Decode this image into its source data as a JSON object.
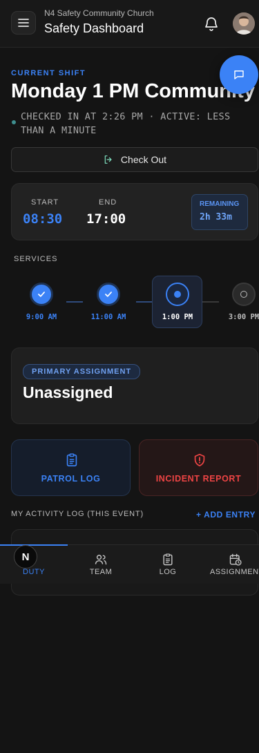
{
  "header": {
    "org_name": "N4 Safety Community Church",
    "title": "Safety Dashboard",
    "menu_icon": "hamburger-icon",
    "bell_icon": "bell-icon"
  },
  "chat_fab_icon": "chat-bubble-icon",
  "shift": {
    "section_label": "CURRENT SHIFT",
    "name": "Monday 1 PM Community",
    "status": "CHECKED IN AT 2:26 PM · ACTIVE: LESS THAN A MINUTE",
    "checkout_label": "Check Out"
  },
  "times": {
    "start_label": "START",
    "start_value": "08:30",
    "end_label": "END",
    "end_value": "17:00",
    "remaining_label": "REMAINING",
    "remaining_value": "2h 33m"
  },
  "services": {
    "label": "SERVICES",
    "items": [
      {
        "time": "9:00 AM",
        "state": "done"
      },
      {
        "time": "11:00 AM",
        "state": "done"
      },
      {
        "time": "1:00 PM",
        "state": "current"
      },
      {
        "time": "3:00 PM",
        "state": "pending"
      }
    ]
  },
  "assignment": {
    "badge": "PRIMARY ASSIGNMENT",
    "value": "Unassigned"
  },
  "actions": {
    "patrol_label": "PATROL LOG",
    "incident_label": "INCIDENT REPORT"
  },
  "activity": {
    "label": "MY ACTIVITY LOG (THIS EVENT)",
    "add_label": "+ ADD ENTRY"
  },
  "nav": {
    "duty": "DUTY",
    "team": "TEAM",
    "log": "LOG",
    "assignments": "ASSIGNMENTS"
  },
  "next_badge": "N",
  "colors": {
    "accent": "#3b82f6",
    "danger": "#ef4444",
    "background": "#141414"
  }
}
